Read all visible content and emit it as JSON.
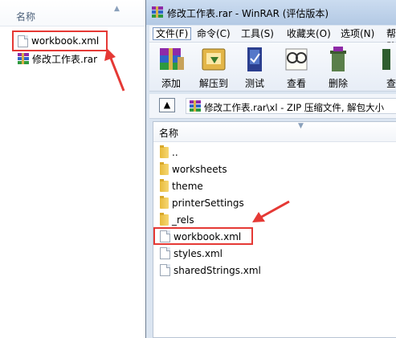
{
  "explorer": {
    "column_header": "名称",
    "files": [
      {
        "name": "workbook.xml",
        "icon": "xml-file-icon"
      },
      {
        "name": "修改工作表.rar",
        "icon": "rar-archive-icon"
      }
    ]
  },
  "winrar": {
    "title": "修改工作表.rar - WinRAR (评估版本)",
    "menu": [
      "文件(F)",
      "命令(C)",
      "工具(S)",
      "收藏夹(O)",
      "选项(N)",
      "帮助"
    ],
    "toolbar": [
      {
        "label": "添加",
        "icon": "add-icon"
      },
      {
        "label": "解压到",
        "icon": "extract-to-icon"
      },
      {
        "label": "测试",
        "icon": "test-icon"
      },
      {
        "label": "查看",
        "icon": "view-icon"
      },
      {
        "label": "删除",
        "icon": "delete-icon"
      },
      {
        "label": "查",
        "icon": "find-icon"
      }
    ],
    "address": "修改工作表.rar\\xl - ZIP 压缩文件, 解包大小",
    "list_header": "名称",
    "entries": [
      {
        "name": "..",
        "type": "folder"
      },
      {
        "name": "worksheets",
        "type": "folder"
      },
      {
        "name": "theme",
        "type": "folder"
      },
      {
        "name": "printerSettings",
        "type": "folder"
      },
      {
        "name": "_rels",
        "type": "folder"
      },
      {
        "name": "workbook.xml",
        "type": "file"
      },
      {
        "name": "styles.xml",
        "type": "file"
      },
      {
        "name": "sharedStrings.xml",
        "type": "file"
      }
    ]
  },
  "colors": {
    "annotation": "#e53935",
    "window_frame": "#dbe5f1"
  }
}
